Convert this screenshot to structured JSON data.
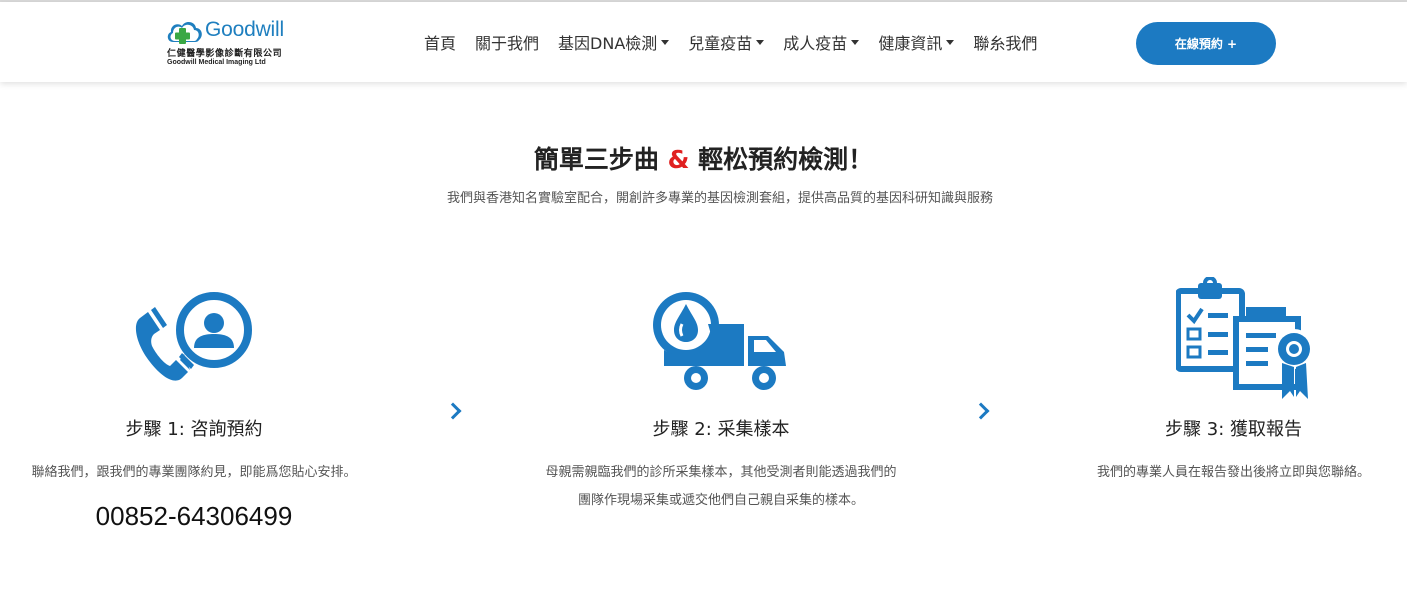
{
  "header": {
    "logo": {
      "name": "Goodwill",
      "subtitle_cn": "仁健醫學影像診斷有限公司",
      "subtitle_en": "Goodwill Medical Imaging Ltd"
    },
    "nav": [
      {
        "label": "首頁",
        "dropdown": false
      },
      {
        "label": "關于我們",
        "dropdown": false
      },
      {
        "label": "基因DNA檢測",
        "dropdown": true
      },
      {
        "label": "兒童疫苗",
        "dropdown": true
      },
      {
        "label": "成人疫苗",
        "dropdown": true
      },
      {
        "label": "健康資訊",
        "dropdown": true
      },
      {
        "label": "聯糸我們",
        "dropdown": false
      }
    ],
    "cta_label": "在線預約 +"
  },
  "hero": {
    "title_before": "簡單三步曲 ",
    "title_amp": "&",
    "title_after": " 輕松預約檢測！",
    "subtitle": "我們與香港知名實驗室配合，開創許多專業的基因檢測套組，提供高品質的基因科研知識與服務"
  },
  "steps": [
    {
      "title": "步驟 1: 咨詢預約",
      "desc_lines": [
        "聯絡我們，跟我們的專業團隊約見，即能爲您貼心安排。"
      ],
      "phone": "00852-64306499",
      "icon": "phone-contact-icon"
    },
    {
      "title": "步驟 2: 采集樣本",
      "desc_lines": [
        "母親需親臨我們的診所采集樣本，其他受測者則能透過我們的",
        "團隊作現場采集或遞交他們自己親自采集的樣本。"
      ],
      "icon": "delivery-truck-icon"
    },
    {
      "title": "步驟 3: 獲取報告",
      "desc_lines": [
        "我們的專業人員在報告發出後將立即與您聯絡。"
      ],
      "icon": "report-certificate-icon"
    }
  ],
  "colors": {
    "accent": "#1c7ac2",
    "highlight": "#e02020",
    "logo_green": "#3aa845"
  }
}
